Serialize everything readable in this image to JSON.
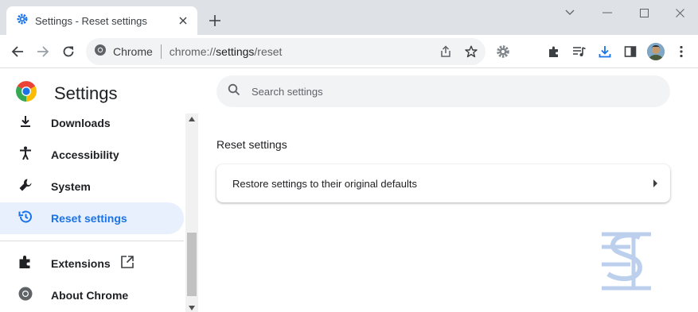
{
  "tab": {
    "title": "Settings - Reset settings"
  },
  "omnibox": {
    "site": "Chrome",
    "url_scheme": "chrome://",
    "url_host": "settings",
    "url_path": "/reset"
  },
  "sidebar": {
    "title": "Settings",
    "items": [
      {
        "label": "Downloads",
        "icon": "download-icon"
      },
      {
        "label": "Accessibility",
        "icon": "accessibility-icon"
      },
      {
        "label": "System",
        "icon": "wrench-icon"
      },
      {
        "label": "Reset settings",
        "icon": "reset-history-icon",
        "active": true
      },
      {
        "label": "Extensions",
        "icon": "puzzle-icon"
      },
      {
        "label": "About Chrome",
        "icon": "chrome-logo-icon"
      }
    ]
  },
  "search": {
    "placeholder": "Search settings"
  },
  "main": {
    "section_title": "Reset settings",
    "restore_label": "Restore settings to their original defaults"
  },
  "colors": {
    "accent": "#1a73e8",
    "active_bg": "#e8f0fe",
    "tabstrip": "#dee1e6",
    "watermark": "#bcd0ee"
  }
}
